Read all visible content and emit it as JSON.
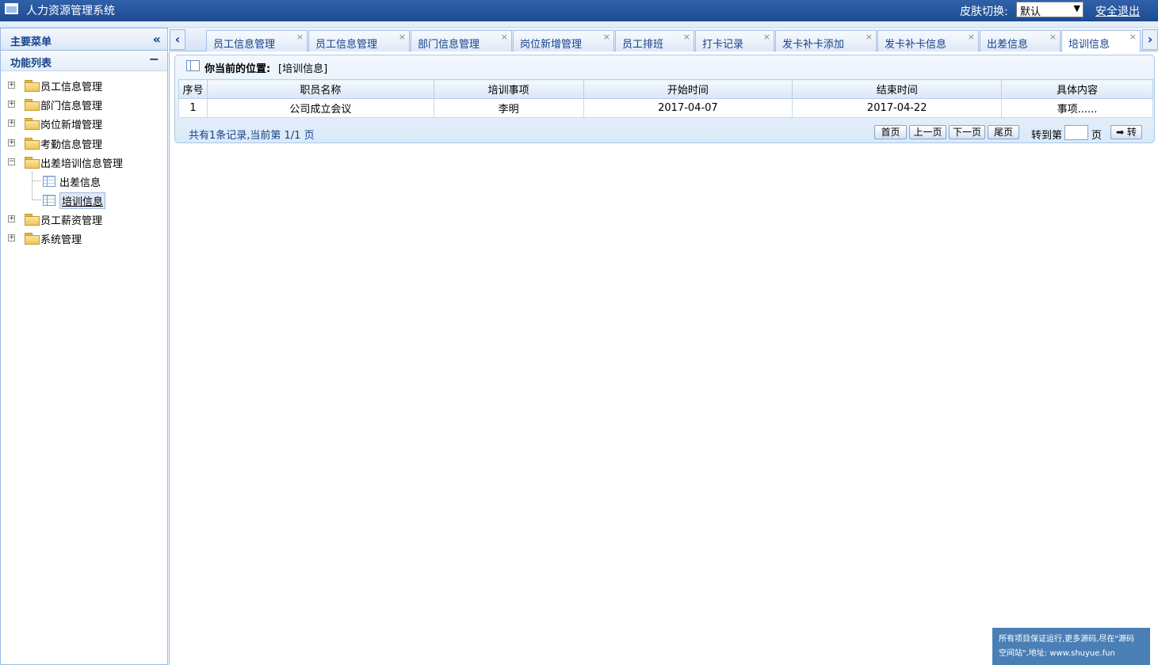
{
  "header": {
    "app_title": "人力资源管理系统",
    "skin_label": "皮肤切换:",
    "skin_value": "默认",
    "logout_label": "安全退出"
  },
  "sidebar": {
    "title": "主要菜单",
    "collapse_icon": "«",
    "section_title": "功能列表",
    "section_toggle": "−",
    "tree": [
      {
        "label": "员工信息管理",
        "toggle": "+"
      },
      {
        "label": "部门信息管理",
        "toggle": "+"
      },
      {
        "label": "岗位新增管理",
        "toggle": "+"
      },
      {
        "label": "考勤信息管理",
        "toggle": "+"
      },
      {
        "label": "出差培训信息管理",
        "toggle": "−"
      },
      {
        "label": "出差信息"
      },
      {
        "label": "培训信息"
      },
      {
        "label": "员工薪资管理",
        "toggle": "+"
      },
      {
        "label": "系统管理",
        "toggle": "+"
      }
    ]
  },
  "tabs": [
    {
      "label": "员工信息管理",
      "close": "×"
    },
    {
      "label": "员工信息管理",
      "close": "×"
    },
    {
      "label": "部门信息管理",
      "close": "×"
    },
    {
      "label": "岗位新增管理",
      "close": "×"
    },
    {
      "label": "员工排班",
      "close": "×"
    },
    {
      "label": "打卡记录",
      "close": "×"
    },
    {
      "label": "发卡补卡添加",
      "close": "×"
    },
    {
      "label": "发卡补卡信息",
      "close": "×"
    },
    {
      "label": "出差信息",
      "close": "×"
    },
    {
      "label": "培训信息",
      "close": "×"
    }
  ],
  "tab_nav": {
    "prev": "‹",
    "next": "›"
  },
  "breadcrumb": {
    "prefix": "你当前的位置:",
    "value": "[培训信息]"
  },
  "table": {
    "columns": [
      "序号",
      "职员名称",
      "培训事项",
      "开始时间",
      "结束时间",
      "具体内容"
    ],
    "rows": [
      [
        "1",
        "公司成立会议",
        "李明",
        "2017-04-07",
        "2017-04-22",
        "事项......"
      ]
    ]
  },
  "pager": {
    "summary": "共有1条记录,当前第 1/1 页",
    "first": "首页",
    "prev": "上一页",
    "next": "下一页",
    "last": "尾页",
    "goto_label": "转到第",
    "goto_unit": "页",
    "go": "➡ 转"
  },
  "watermark": {
    "line1": "所有项目保证运行,更多源码,尽在\"源码",
    "line2": "空间站\",地址: www.shuyue.fun"
  },
  "colors": {
    "header_bg": "#1e4b8f",
    "panel_border": "#99bbe8",
    "link_text": "#15428b"
  }
}
